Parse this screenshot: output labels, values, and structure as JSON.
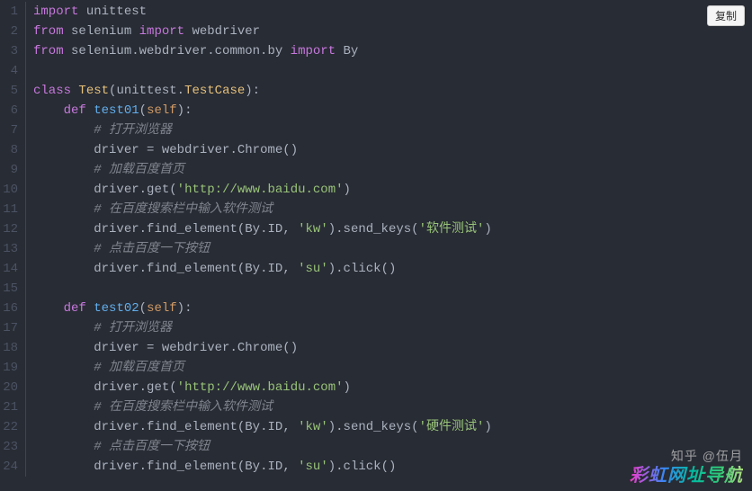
{
  "copy_button_label": "复制",
  "watermark_zhihu": "知乎 @伍月",
  "watermark_rainbow": "彩虹网址导航",
  "gutter": [
    "1",
    "2",
    "3",
    "4",
    "5",
    "6",
    "7",
    "8",
    "9",
    "10",
    "11",
    "12",
    "13",
    "14",
    "15",
    "16",
    "17",
    "18",
    "19",
    "20",
    "21",
    "22",
    "23",
    "24"
  ],
  "lines": [
    [
      [
        "keyword",
        "import"
      ],
      [
        "punct",
        " "
      ],
      [
        "module",
        "unittest"
      ]
    ],
    [
      [
        "keyword",
        "from"
      ],
      [
        "punct",
        " "
      ],
      [
        "module",
        "selenium"
      ],
      [
        "punct",
        " "
      ],
      [
        "keyword",
        "import"
      ],
      [
        "punct",
        " "
      ],
      [
        "module",
        "webdriver"
      ]
    ],
    [
      [
        "keyword",
        "from"
      ],
      [
        "punct",
        " "
      ],
      [
        "module",
        "selenium.webdriver.common.by"
      ],
      [
        "punct",
        " "
      ],
      [
        "keyword",
        "import"
      ],
      [
        "punct",
        " "
      ],
      [
        "module",
        "By"
      ]
    ],
    [],
    [
      [
        "keyword",
        "class"
      ],
      [
        "punct",
        " "
      ],
      [
        "classname",
        "Test"
      ],
      [
        "punct",
        "("
      ],
      [
        "module",
        "unittest"
      ],
      [
        "punct",
        "."
      ],
      [
        "classname",
        "TestCase"
      ],
      [
        "punct",
        "):"
      ]
    ],
    [
      [
        "punct",
        "    "
      ],
      [
        "keyword",
        "def"
      ],
      [
        "punct",
        " "
      ],
      [
        "funcname",
        "test01"
      ],
      [
        "punct",
        "("
      ],
      [
        "param",
        "self"
      ],
      [
        "punct",
        "):"
      ]
    ],
    [
      [
        "punct",
        "        "
      ],
      [
        "comment",
        "# 打开浏览器"
      ]
    ],
    [
      [
        "punct",
        "        "
      ],
      [
        "attr",
        "driver "
      ],
      [
        "punct",
        "= "
      ],
      [
        "attr",
        "webdriver"
      ],
      [
        "punct",
        "."
      ],
      [
        "method",
        "Chrome"
      ],
      [
        "punct",
        "()"
      ]
    ],
    [
      [
        "punct",
        "        "
      ],
      [
        "comment",
        "# 加载百度首页"
      ]
    ],
    [
      [
        "punct",
        "        "
      ],
      [
        "attr",
        "driver"
      ],
      [
        "punct",
        "."
      ],
      [
        "method",
        "get"
      ],
      [
        "punct",
        "("
      ],
      [
        "string",
        "'http://www.baidu.com'"
      ],
      [
        "punct",
        ")"
      ]
    ],
    [
      [
        "punct",
        "        "
      ],
      [
        "comment",
        "# 在百度搜索栏中输入软件测试"
      ]
    ],
    [
      [
        "punct",
        "        "
      ],
      [
        "attr",
        "driver"
      ],
      [
        "punct",
        "."
      ],
      [
        "method",
        "find_element"
      ],
      [
        "punct",
        "("
      ],
      [
        "attr",
        "By"
      ],
      [
        "punct",
        "."
      ],
      [
        "attr",
        "ID"
      ],
      [
        "punct",
        ", "
      ],
      [
        "string",
        "'kw'"
      ],
      [
        "punct",
        ")."
      ],
      [
        "method",
        "send_keys"
      ],
      [
        "punct",
        "("
      ],
      [
        "string",
        "'软件测试'"
      ],
      [
        "punct",
        ")"
      ]
    ],
    [
      [
        "punct",
        "        "
      ],
      [
        "comment",
        "# 点击百度一下按钮"
      ]
    ],
    [
      [
        "punct",
        "        "
      ],
      [
        "attr",
        "driver"
      ],
      [
        "punct",
        "."
      ],
      [
        "method",
        "find_element"
      ],
      [
        "punct",
        "("
      ],
      [
        "attr",
        "By"
      ],
      [
        "punct",
        "."
      ],
      [
        "attr",
        "ID"
      ],
      [
        "punct",
        ", "
      ],
      [
        "string",
        "'su'"
      ],
      [
        "punct",
        ")."
      ],
      [
        "method",
        "click"
      ],
      [
        "punct",
        "()"
      ]
    ],
    [],
    [
      [
        "punct",
        "    "
      ],
      [
        "keyword",
        "def"
      ],
      [
        "punct",
        " "
      ],
      [
        "funcname",
        "test02"
      ],
      [
        "punct",
        "("
      ],
      [
        "param",
        "self"
      ],
      [
        "punct",
        "):"
      ]
    ],
    [
      [
        "punct",
        "        "
      ],
      [
        "comment",
        "# 打开浏览器"
      ]
    ],
    [
      [
        "punct",
        "        "
      ],
      [
        "attr",
        "driver "
      ],
      [
        "punct",
        "= "
      ],
      [
        "attr",
        "webdriver"
      ],
      [
        "punct",
        "."
      ],
      [
        "method",
        "Chrome"
      ],
      [
        "punct",
        "()"
      ]
    ],
    [
      [
        "punct",
        "        "
      ],
      [
        "comment",
        "# 加载百度首页"
      ]
    ],
    [
      [
        "punct",
        "        "
      ],
      [
        "attr",
        "driver"
      ],
      [
        "punct",
        "."
      ],
      [
        "method",
        "get"
      ],
      [
        "punct",
        "("
      ],
      [
        "string",
        "'http://www.baidu.com'"
      ],
      [
        "punct",
        ")"
      ]
    ],
    [
      [
        "punct",
        "        "
      ],
      [
        "comment",
        "# 在百度搜索栏中输入软件测试"
      ]
    ],
    [
      [
        "punct",
        "        "
      ],
      [
        "attr",
        "driver"
      ],
      [
        "punct",
        "."
      ],
      [
        "method",
        "find_element"
      ],
      [
        "punct",
        "("
      ],
      [
        "attr",
        "By"
      ],
      [
        "punct",
        "."
      ],
      [
        "attr",
        "ID"
      ],
      [
        "punct",
        ", "
      ],
      [
        "string",
        "'kw'"
      ],
      [
        "punct",
        ")."
      ],
      [
        "method",
        "send_keys"
      ],
      [
        "punct",
        "("
      ],
      [
        "string",
        "'硬件测试'"
      ],
      [
        "punct",
        ")"
      ]
    ],
    [
      [
        "punct",
        "        "
      ],
      [
        "comment",
        "# 点击百度一下按钮"
      ]
    ],
    [
      [
        "punct",
        "        "
      ],
      [
        "attr",
        "driver"
      ],
      [
        "punct",
        "."
      ],
      [
        "method",
        "find_element"
      ],
      [
        "punct",
        "("
      ],
      [
        "attr",
        "By"
      ],
      [
        "punct",
        "."
      ],
      [
        "attr",
        "ID"
      ],
      [
        "punct",
        ", "
      ],
      [
        "string",
        "'su'"
      ],
      [
        "punct",
        ")."
      ],
      [
        "method",
        "click"
      ],
      [
        "punct",
        "()"
      ]
    ]
  ]
}
